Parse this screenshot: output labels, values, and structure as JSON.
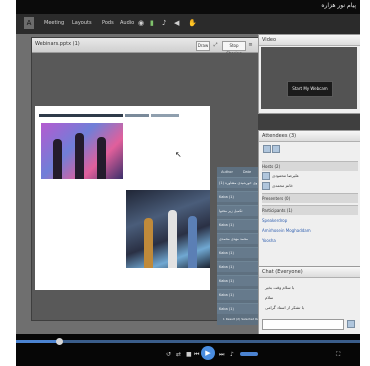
{
  "brand_text": "پیام نور هزاره",
  "menu": [
    "Meeting",
    "Layouts",
    "Pods",
    "Audio"
  ],
  "icons": [
    "presenter-icon",
    "webcam-icon",
    "microphone-icon",
    "speaker-icon",
    "status-icon"
  ],
  "share_pod": {
    "title": "Webinars.pptx (1)",
    "draw_label": "Draw",
    "stop_sharing_label": "Stop Sharing",
    "page_counter": "1/1"
  },
  "slide": {
    "table": {
      "headers": [
        "Author",
        "Date",
        "Result"
      ],
      "rows": [
        {
          "name": "نبوی خورشیدی مشاوره (1)",
          "value": "10:35"
        },
        {
          "name": "Kaba (1)",
          "value": "10:35"
        },
        {
          "name": "تکمیل زیر محتوا",
          "value": "10:35"
        },
        {
          "name": "Kaba (1)",
          "value": "10:35"
        },
        {
          "name": "محمد مهدی محمدی",
          "value": "10:35"
        },
        {
          "name": "Kaba (1)",
          "value": "10:35"
        },
        {
          "name": "Kaba (1)",
          "value": "10:35"
        },
        {
          "name": "Kaba (1)",
          "value": "10:35"
        },
        {
          "name": "Kaba (1)",
          "value": "10:35"
        },
        {
          "name": "Kaba (1)",
          "value": "10:35"
        }
      ],
      "footer": "1 Result (2) Selected Remaining"
    }
  },
  "video_pod": {
    "title": "Video",
    "start_button": "Start My Webcam"
  },
  "attendees_pod": {
    "title": "Attendees (3)",
    "sections": [
      {
        "label": "Hosts (2)",
        "type": "section"
      },
      {
        "label": "علیرضا محمودی",
        "type": "person"
      },
      {
        "label": "خانم محمدی",
        "type": "person"
      },
      {
        "label": "Presenters (0)",
        "type": "section"
      },
      {
        "label": "Participants (1)",
        "type": "section"
      },
      {
        "label": "Speakerdrop",
        "type": "link"
      },
      {
        "label": "Amirhosein Moghaddam",
        "type": "link"
      },
      {
        "label": "Yoosha",
        "type": "link"
      }
    ]
  },
  "chat_pod": {
    "title": "Chat (Everyone)",
    "messages": [
      "با سلام وقت بخیر",
      "سلام",
      "با تشکر از استاد گرامی"
    ]
  },
  "player": {
    "progress_percent": 13
  },
  "colors": {
    "slide_background": "#ffffff",
    "table_header": "#5e7080",
    "progress": "#4b83d1"
  }
}
